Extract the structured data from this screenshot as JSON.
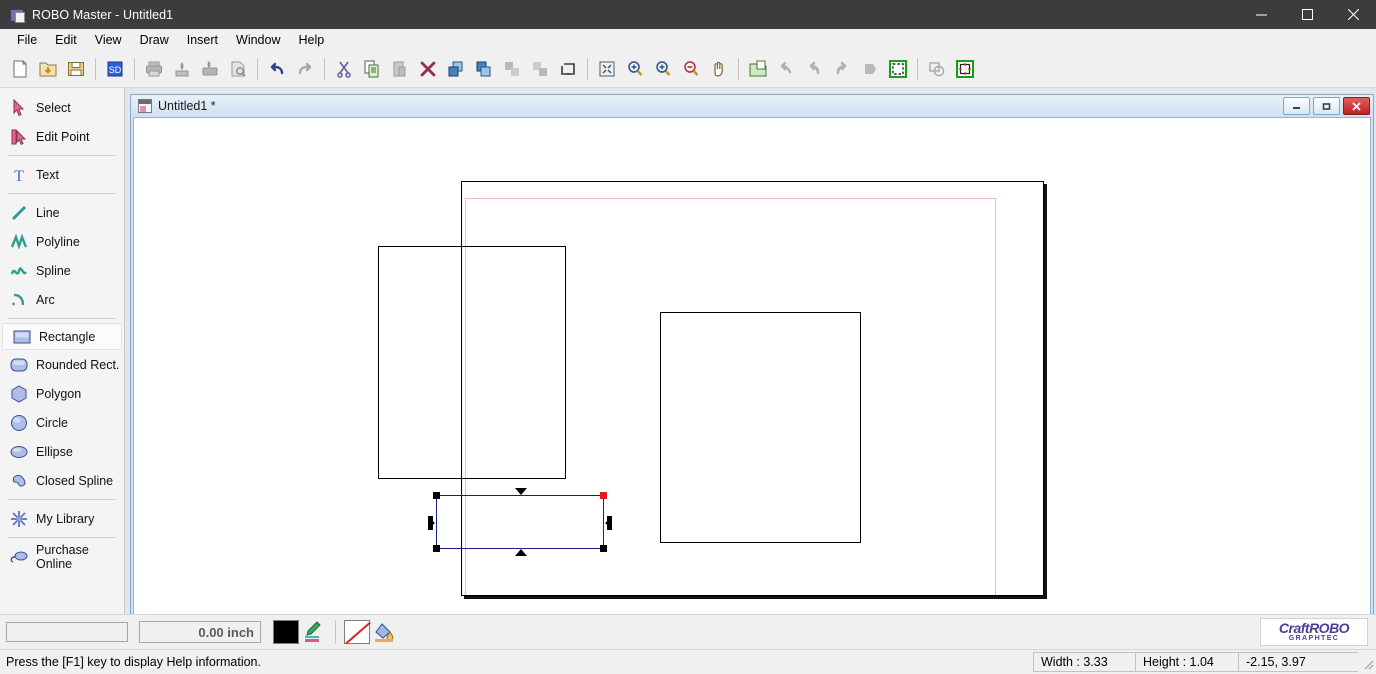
{
  "window": {
    "title": "ROBO Master - Untitled1",
    "app_icon": "robo-master-icon",
    "controls": {
      "minimize": "minimize-icon",
      "maximize": "maximize-icon",
      "close": "close-icon"
    }
  },
  "menubar": {
    "items": [
      {
        "label": "File"
      },
      {
        "label": "Edit"
      },
      {
        "label": "View"
      },
      {
        "label": "Draw"
      },
      {
        "label": "Insert"
      },
      {
        "label": "Window"
      },
      {
        "label": "Help"
      }
    ]
  },
  "toolbar": {
    "groups": [
      {
        "buttons": [
          {
            "name": "new-file-icon",
            "enabled": true
          },
          {
            "name": "open-file-icon",
            "enabled": true
          },
          {
            "name": "save-file-icon",
            "enabled": true
          }
        ]
      },
      {
        "buttons": [
          {
            "name": "sd-card-icon",
            "enabled": true
          }
        ]
      },
      {
        "buttons": [
          {
            "name": "print-icon",
            "enabled": false
          },
          {
            "name": "cut-plot-icon",
            "enabled": false
          },
          {
            "name": "print-and-cut-icon",
            "enabled": false
          },
          {
            "name": "print-preview-icon",
            "enabled": false
          }
        ]
      },
      {
        "buttons": [
          {
            "name": "undo-icon",
            "enabled": true
          },
          {
            "name": "redo-icon",
            "enabled": false
          }
        ]
      },
      {
        "buttons": [
          {
            "name": "cut-icon",
            "enabled": true
          },
          {
            "name": "copy-icon",
            "enabled": true
          },
          {
            "name": "paste-icon",
            "enabled": false
          },
          {
            "name": "delete-icon",
            "enabled": true
          },
          {
            "name": "bring-to-front-icon",
            "enabled": true
          },
          {
            "name": "send-to-back-icon",
            "enabled": true
          },
          {
            "name": "group-icon",
            "enabled": false
          },
          {
            "name": "ungroup-icon",
            "enabled": false
          },
          {
            "name": "object-outline-icon",
            "enabled": true
          }
        ]
      },
      {
        "buttons": [
          {
            "name": "fit-to-window-icon",
            "enabled": true
          },
          {
            "name": "zoom-in-icon",
            "enabled": true
          },
          {
            "name": "zoom-selection-icon",
            "enabled": true
          },
          {
            "name": "zoom-out-icon",
            "enabled": true
          },
          {
            "name": "pan-hand-icon",
            "enabled": true
          }
        ]
      },
      {
        "buttons": [
          {
            "name": "media-settings-icon",
            "enabled": true
          },
          {
            "name": "rotate-left-icon",
            "enabled": false
          },
          {
            "name": "flip-horizontal-icon",
            "enabled": false
          },
          {
            "name": "rotate-right-icon",
            "enabled": false
          },
          {
            "name": "mirror-icon",
            "enabled": false
          },
          {
            "name": "registration-marks-icon",
            "enabled": true
          }
        ]
      },
      {
        "buttons": [
          {
            "name": "weld-shapes-icon",
            "enabled": false
          },
          {
            "name": "cut-area-icon",
            "enabled": true
          }
        ]
      }
    ]
  },
  "sidebar": {
    "items": [
      {
        "label": "Select",
        "icon": "select-arrow-icon",
        "active": false
      },
      {
        "label": "Edit Point",
        "icon": "edit-point-icon",
        "active": false
      },
      {
        "separator_after": true
      },
      {
        "label": "Text",
        "icon": "text-icon",
        "active": false
      },
      {
        "separator_after": true
      },
      {
        "label": "Line",
        "icon": "line-icon",
        "active": false
      },
      {
        "label": "Polyline",
        "icon": "polyline-icon",
        "active": false
      },
      {
        "label": "Spline",
        "icon": "spline-icon",
        "active": false
      },
      {
        "label": "Arc",
        "icon": "arc-icon",
        "active": false
      },
      {
        "separator_after": true
      },
      {
        "label": "Rectangle",
        "icon": "rectangle-icon",
        "active": true
      },
      {
        "label": "Rounded Rect.",
        "icon": "rounded-rect-icon",
        "active": false
      },
      {
        "label": "Polygon",
        "icon": "polygon-icon",
        "active": false
      },
      {
        "label": "Circle",
        "icon": "circle-icon",
        "active": false
      },
      {
        "label": "Ellipse",
        "icon": "ellipse-icon",
        "active": false
      },
      {
        "label": "Closed Spline",
        "icon": "closed-spline-icon",
        "active": false
      },
      {
        "separator_after": true
      },
      {
        "label": "My Library",
        "icon": "my-library-icon",
        "active": false
      },
      {
        "separator_after": true
      },
      {
        "label": "Purchase Online",
        "icon": "purchase-online-icon",
        "active": false
      }
    ]
  },
  "document_window": {
    "title": "Untitled1 *",
    "icon": "document-icon",
    "controls": {
      "minimize": "minimize-icon",
      "restore": "restore-icon",
      "close": "close-icon"
    }
  },
  "canvas": {
    "shapes": [
      {
        "name": "rectangle-left",
        "selected": false
      },
      {
        "name": "rectangle-right",
        "selected": false
      },
      {
        "name": "rectangle-selected",
        "selected": true
      }
    ],
    "page": {
      "name": "cutting-page",
      "margin_color": "#f0b9bc"
    }
  },
  "bottom_bar": {
    "name_field": {
      "value": "",
      "placeholder": ""
    },
    "size_field": {
      "value": "0.00 inch"
    },
    "line_color_swatch": "#000000",
    "pen_icon": "pen-color-icon",
    "fill_swatch": "none",
    "fill_icon": "fill-bucket-icon",
    "logo": {
      "line1": "CraftROBO",
      "line2": "GRAPHTEC"
    }
  },
  "status_bar": {
    "hint": "Press the [F1] key to display Help information.",
    "width": "Width : 3.33",
    "height": "Height : 1.04",
    "coordinates": "-2.15, 3.97"
  }
}
